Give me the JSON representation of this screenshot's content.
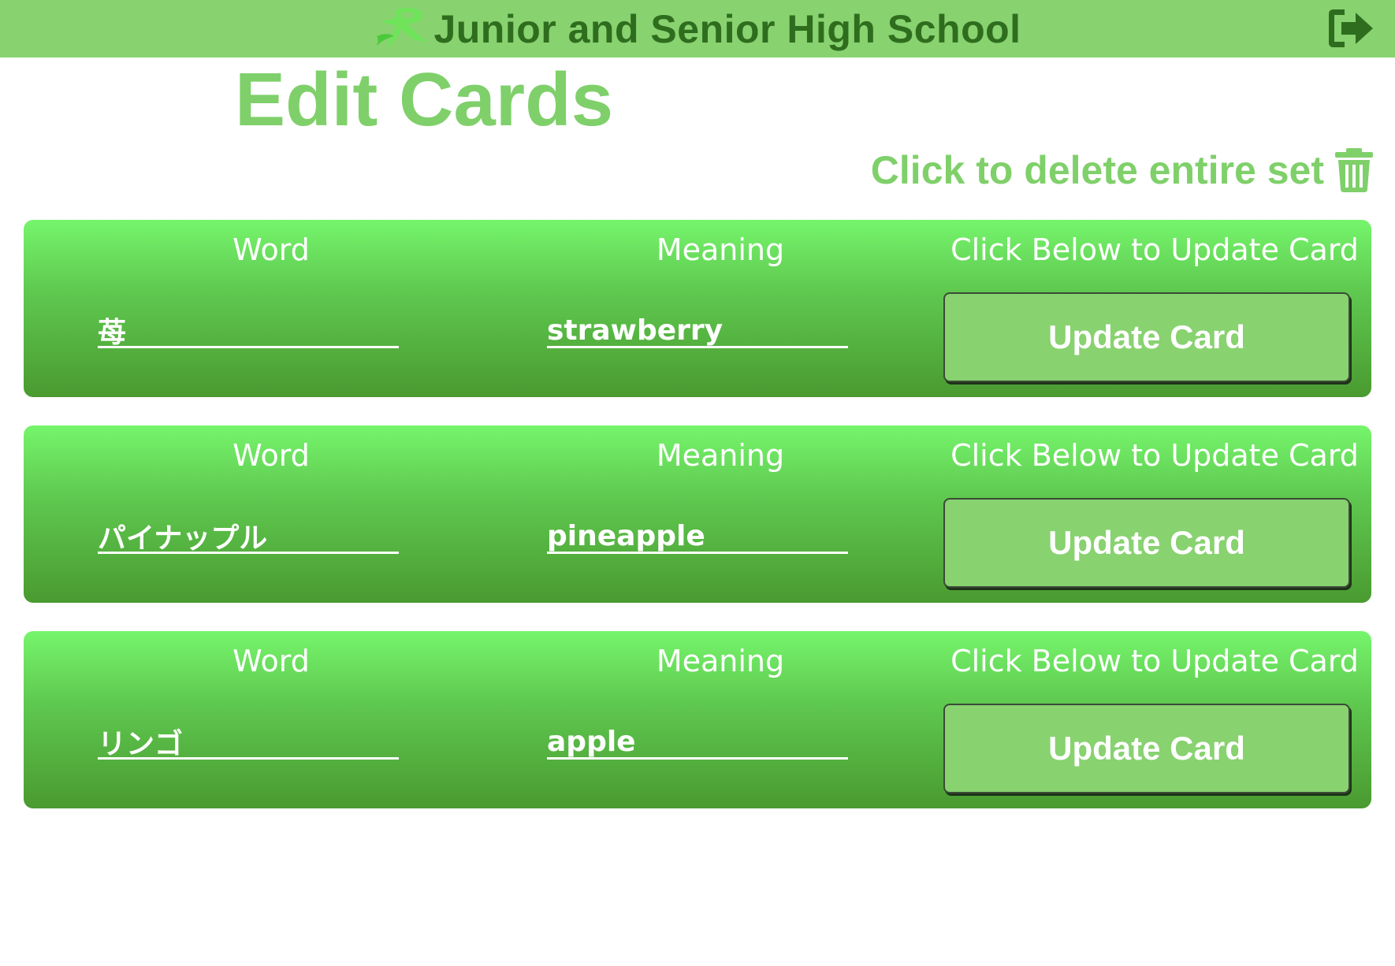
{
  "header": {
    "school_name": "Junior and Senior High School",
    "logo_icon": "swoosh-logo",
    "logout_icon": "sign-out-icon"
  },
  "page": {
    "title": "Edit Cards",
    "delete_set_label": "Click to delete entire set",
    "delete_icon": "trash-icon"
  },
  "cards": [
    {
      "word_label": "Word",
      "meaning_label": "Meaning",
      "update_label": "Click Below to Update Card",
      "word": "苺",
      "meaning": "strawberry",
      "button": "Update Card"
    },
    {
      "word_label": "Word",
      "meaning_label": "Meaning",
      "update_label": "Click Below to Update Card",
      "word": "パイナップル",
      "meaning": "pineapple",
      "button": "Update Card"
    },
    {
      "word_label": "Word",
      "meaning_label": "Meaning",
      "update_label": "Click Below to Update Card",
      "word": "リンゴ",
      "meaning": "apple",
      "button": "Update Card"
    }
  ],
  "colors": {
    "header_bg": "#88d270",
    "header_text": "#2f6d1e",
    "accent": "#7fd06a",
    "card_top": "#76f56c",
    "card_bottom": "#4a9a30",
    "button_bg": "#88d270"
  }
}
